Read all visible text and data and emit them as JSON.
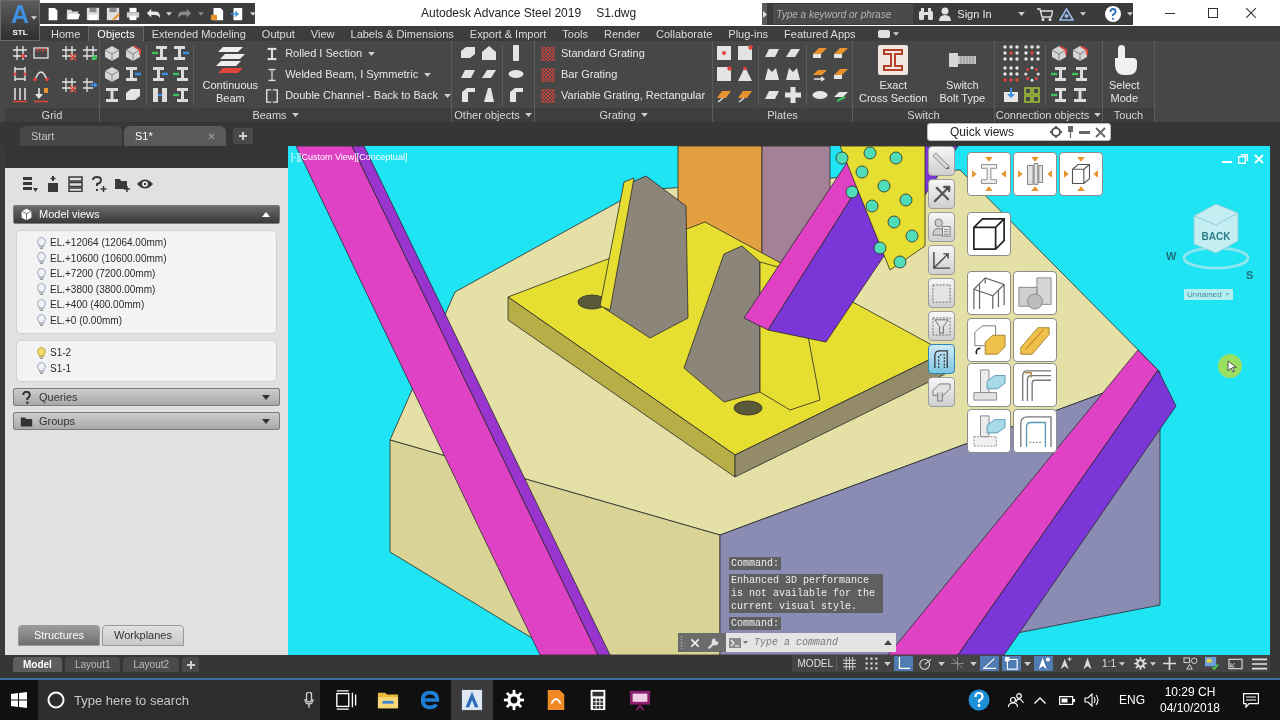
{
  "app_button": {
    "letter": "A",
    "label": "STL"
  },
  "window": {
    "title": "Autodesk Advance Steel 2019",
    "file": "S1.dwg"
  },
  "infocenter": {
    "placeholder": "Type a keyword or phrase",
    "sign_in": "Sign In"
  },
  "ribbon_tabs": [
    {
      "label": "Home",
      "selected": false
    },
    {
      "label": "Objects",
      "selected": true
    },
    {
      "label": "Extended Modeling",
      "selected": false
    },
    {
      "label": "Output",
      "selected": false
    },
    {
      "label": "View",
      "selected": false
    },
    {
      "label": "Labels & Dimensions",
      "selected": false
    },
    {
      "label": "Export & Import",
      "selected": false
    },
    {
      "label": "Tools",
      "selected": false
    },
    {
      "label": "Render",
      "selected": false
    },
    {
      "label": "Collaborate",
      "selected": false
    },
    {
      "label": "Plug-ins",
      "selected": false
    },
    {
      "label": "Featured Apps",
      "selected": false
    }
  ],
  "ribbon_panels": [
    {
      "kind": "grid",
      "title": "Grid",
      "has_menu": false
    },
    {
      "kind": "beams",
      "title": "Beams",
      "has_menu": true,
      "large_buttons": [
        {
          "kind": "continuous-beam",
          "lines": [
            "Continuous",
            "Beam"
          ]
        }
      ],
      "list": [
        {
          "kind": "rolled",
          "label": "Rolled I Section",
          "has_menu": true
        },
        {
          "kind": "welded",
          "label": "Welded Beam, I Symmetric",
          "has_menu": true
        },
        {
          "kind": "channel",
          "label": "Double Channel - Back to Back",
          "has_menu": true
        }
      ]
    },
    {
      "kind": "other",
      "title": "Other objects",
      "has_menu": true
    },
    {
      "kind": "grating",
      "title": "Grating",
      "has_menu": true,
      "list": [
        {
          "kind": "hatch",
          "label": "Standard Grating",
          "has_menu": false
        },
        {
          "kind": "hatch",
          "label": "Bar Grating",
          "has_menu": false
        },
        {
          "kind": "hatch",
          "label": "Variable Grating, Rectangular",
          "has_menu": false
        }
      ]
    },
    {
      "kind": "plates",
      "title": "Plates",
      "has_menu": false
    },
    {
      "kind": "switch",
      "title": "Switch",
      "has_menu": false,
      "large_buttons": [
        {
          "kind": "cross-section",
          "lines": [
            "Exact",
            "Cross Section"
          ]
        },
        {
          "kind": "bolt",
          "lines": [
            "Switch",
            "Bolt Type"
          ]
        }
      ]
    },
    {
      "kind": "connections",
      "title": "Connection objects",
      "has_menu": true
    },
    {
      "kind": "touch",
      "title": "Touch",
      "has_menu": false,
      "large_buttons": [
        {
          "kind": "hand",
          "lines": [
            "Select",
            "Mode"
          ]
        }
      ]
    }
  ],
  "document_tabs": [
    {
      "label": "Start",
      "selected": false,
      "closable": false
    },
    {
      "label": "S1*",
      "selected": true,
      "closable": true
    }
  ],
  "project_explorer": {
    "sections": [
      {
        "kind": "model-views",
        "title": "Model views",
        "expanded": true,
        "groups": [
          [
            {
              "label": "EL.+12064 (12064.00mm)",
              "on": false
            },
            {
              "label": "EL.+10600 (10600.00mm)",
              "on": false
            },
            {
              "label": "EL.+7200 (7200.00mm)",
              "on": false
            },
            {
              "label": "EL.+3800 (3800.00mm)",
              "on": false
            },
            {
              "label": "EL.+400 (400.00mm)",
              "on": false
            },
            {
              "label": "EL.+0 (0.00mm)",
              "on": false
            }
          ],
          [
            {
              "label": "S1-2",
              "on": true
            },
            {
              "label": "S1-1",
              "on": false
            }
          ]
        ]
      },
      {
        "kind": "queries",
        "title": "Queries",
        "expanded": false
      },
      {
        "kind": "groups",
        "title": "Groups",
        "expanded": false
      }
    ],
    "tabs": [
      {
        "label": "Structures",
        "selected": true
      },
      {
        "label": "Workplanes",
        "selected": false
      }
    ]
  },
  "viewport": {
    "label": "[-][Custom View][Conceptual]",
    "view_cube": {
      "face": "BACK",
      "compass": [
        "W",
        "S"
      ]
    },
    "named_view": "Unnamed"
  },
  "quick_views": {
    "title": "Quick views",
    "tools": [
      {
        "kind": "pencil",
        "selected": false
      },
      {
        "kind": "tools",
        "selected": false
      },
      {
        "kind": "person",
        "selected": false
      },
      {
        "kind": "axes",
        "selected": false
      },
      {
        "kind": "dashed-square",
        "selected": false
      },
      {
        "kind": "funnel",
        "selected": false
      },
      {
        "kind": "bent-plate",
        "selected": true
      },
      {
        "kind": "beam-joint",
        "selected": false
      }
    ],
    "views": [
      [
        {
          "kind": "section-arrows"
        },
        {
          "kind": "column-arrows"
        },
        {
          "kind": "cube-arrows"
        }
      ],
      [
        {
          "kind": "cube"
        }
      ],
      [
        {
          "kind": "frame"
        },
        {
          "kind": "shapes"
        }
      ],
      [
        {
          "kind": "box-corner"
        },
        {
          "kind": "bar"
        }
      ],
      [
        {
          "kind": "column-base"
        },
        {
          "kind": "profile-corner"
        }
      ],
      [
        {
          "kind": "column-base-dashed"
        },
        {
          "kind": "bent-profile"
        }
      ]
    ]
  },
  "command_window": {
    "history": [
      {
        "kind": "prompt",
        "text": "Command:"
      },
      {
        "kind": "message",
        "text": "Enhanced 3D performance is not available for the current visual style."
      },
      {
        "kind": "prompt",
        "text": "Command:"
      }
    ],
    "placeholder": "Type a command"
  },
  "layout_tabs": [
    {
      "label": "Model",
      "selected": true
    },
    {
      "label": "Layout1",
      "selected": false
    },
    {
      "label": "Layout2",
      "selected": false
    }
  ],
  "status_bar": {
    "space": "MODEL",
    "toggles": [
      {
        "kind": "grid",
        "on": false,
        "has_menu": false
      },
      {
        "kind": "snap",
        "on": false,
        "has_menu": true
      },
      {
        "kind": "ortho",
        "on": true,
        "has_menu": false
      },
      {
        "kind": "polar",
        "on": false,
        "has_menu": true
      },
      {
        "kind": "tracking",
        "on": false,
        "has_menu": true
      },
      {
        "kind": "isodraft",
        "on": true,
        "has_menu": false
      },
      {
        "kind": "osnap",
        "on": true,
        "has_menu": true
      },
      {
        "kind": "annotation-visibility",
        "on": true,
        "has_menu": false
      },
      {
        "kind": "autoscale",
        "on": false,
        "has_menu": false
      },
      {
        "kind": "annotation",
        "on": false,
        "has_menu": false
      }
    ],
    "scale": "1:1"
  },
  "taskbar": {
    "placeholder": "Type here to search",
    "apps": [
      {
        "kind": "task-view",
        "active": false
      },
      {
        "kind": "file-explorer",
        "active": false
      },
      {
        "kind": "browser",
        "active": false
      },
      {
        "kind": "advance-steel",
        "active": true
      },
      {
        "kind": "settings",
        "active": false
      },
      {
        "kind": "pdf",
        "active": false
      },
      {
        "kind": "calculator",
        "active": false
      },
      {
        "kind": "presentation",
        "active": false
      }
    ],
    "language": "ENG",
    "time": "10:29 CH",
    "date": "04/10/2018"
  }
}
